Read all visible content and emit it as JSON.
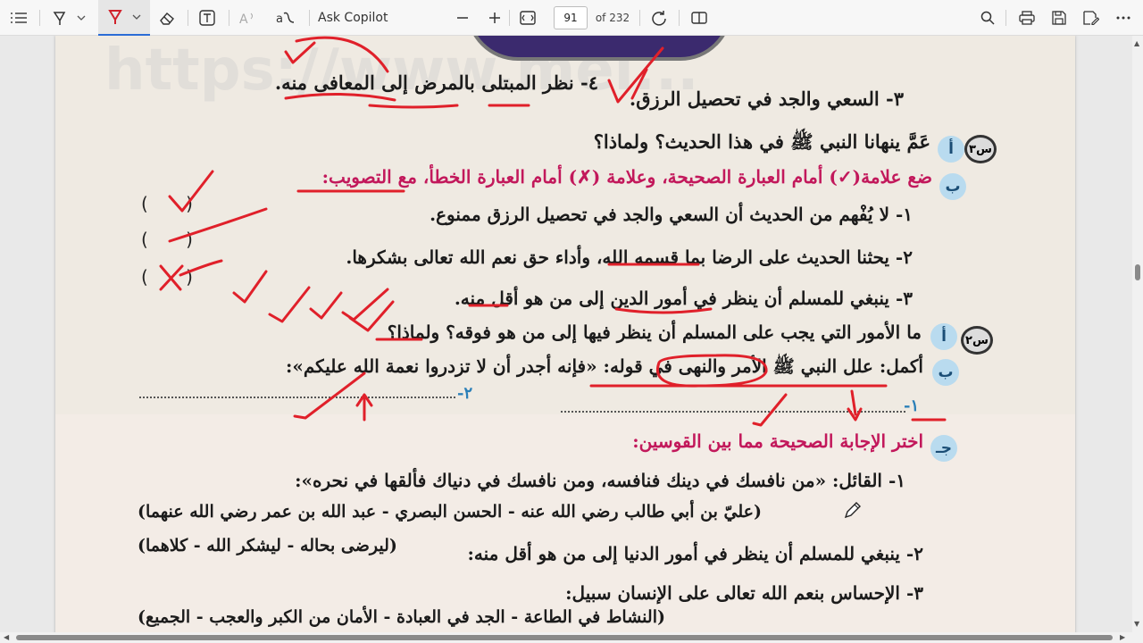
{
  "toolbar": {
    "ask_copilot": "Ask Copilot",
    "page_number": "91",
    "page_total": "of 232",
    "icons": [
      "contents-icon",
      "draw-icon",
      "highlight-icon",
      "eraser-icon",
      "text-icon",
      "read-aloud-icon",
      "translate-icon",
      "zoom-out-icon",
      "zoom-in-icon",
      "fit-page-icon",
      "rotate-icon",
      "page-view-icon",
      "search-icon",
      "print-icon",
      "save-icon",
      "save-as-icon",
      "more-icon"
    ]
  },
  "document": {
    "line_q3": "٣- السعي والجد في تحصيل الرزق.",
    "line_q4": "٤- نظر المبتلى بالمرض إلى المعافى منه.",
    "s3_label": "س٣",
    "a_label": "أ",
    "s3a": "عَمَّ ينهانا النبي ﷺ في هذا الحديث؟ ولماذا؟",
    "b_label": "ب",
    "s3b": "ضع علامة(✓) أمام العبارة الصحيحة، وعلامة (✗) أمام العبارة الخطأ، مع التصويب:",
    "s3b_1": "١- لا يُفْهم من الحديث أن السعي والجد في تحصيل الرزق ممنوع.",
    "s3b_2": "٢- يحثنا الحديث على الرضا بما قسمه الله، وأداء حق نعم الله تعالى بشكرها.",
    "s3b_3": "٣- ينبغي للمسلم أن ينظر في أمور الدين إلى من هو أقل منه.",
    "paren": "(   )",
    "s2_label": "س٢",
    "s2a": "ما الأمور التي يجب على المسلم أن ينظر فيها إلى من هو فوقه؟ ولماذا؟",
    "s2b": "أكمل: علل النبي ﷺ الأمر والنهى في قوله: «فإنه أجدر أن لا تزدروا نعمة الله عليكم»:",
    "blank_1": "١-",
    "blank_2": "٢-",
    "j_label": "جـ",
    "j_title": "اختر الإجابة الصحيحة مما بين القوسين:",
    "j1": "١- القائل: «من نافسك في دينك فنافسه، ومن نافسك في دنياك فألقها في نحره»:",
    "j1_opts": "(عليّ بن أبي طالب رضي الله عنه - الحسن البصري - عبد الله بن عمر رضي الله عنهما)",
    "j2": "٢- ينبغي للمسلم أن ينظر في أمور الدنيا إلى من هو أقل منه:",
    "j2_opts": "(ليرضى بحاله - ليشكر الله - كلاهما)",
    "j3": "٣- الإحساس بنعم الله تعالى على الإنسان سبيل:",
    "j3_opts": "(النشاط في الطاعة - الجد في العبادة - الأمان من الكبر والعجب - الجميع)",
    "watermark": "https://www.mel..."
  },
  "colors": {
    "accent": "#2b6cd6",
    "ink": "#e0202a",
    "question_pink": "#c2185b",
    "number_blue": "#2a7fb8"
  }
}
